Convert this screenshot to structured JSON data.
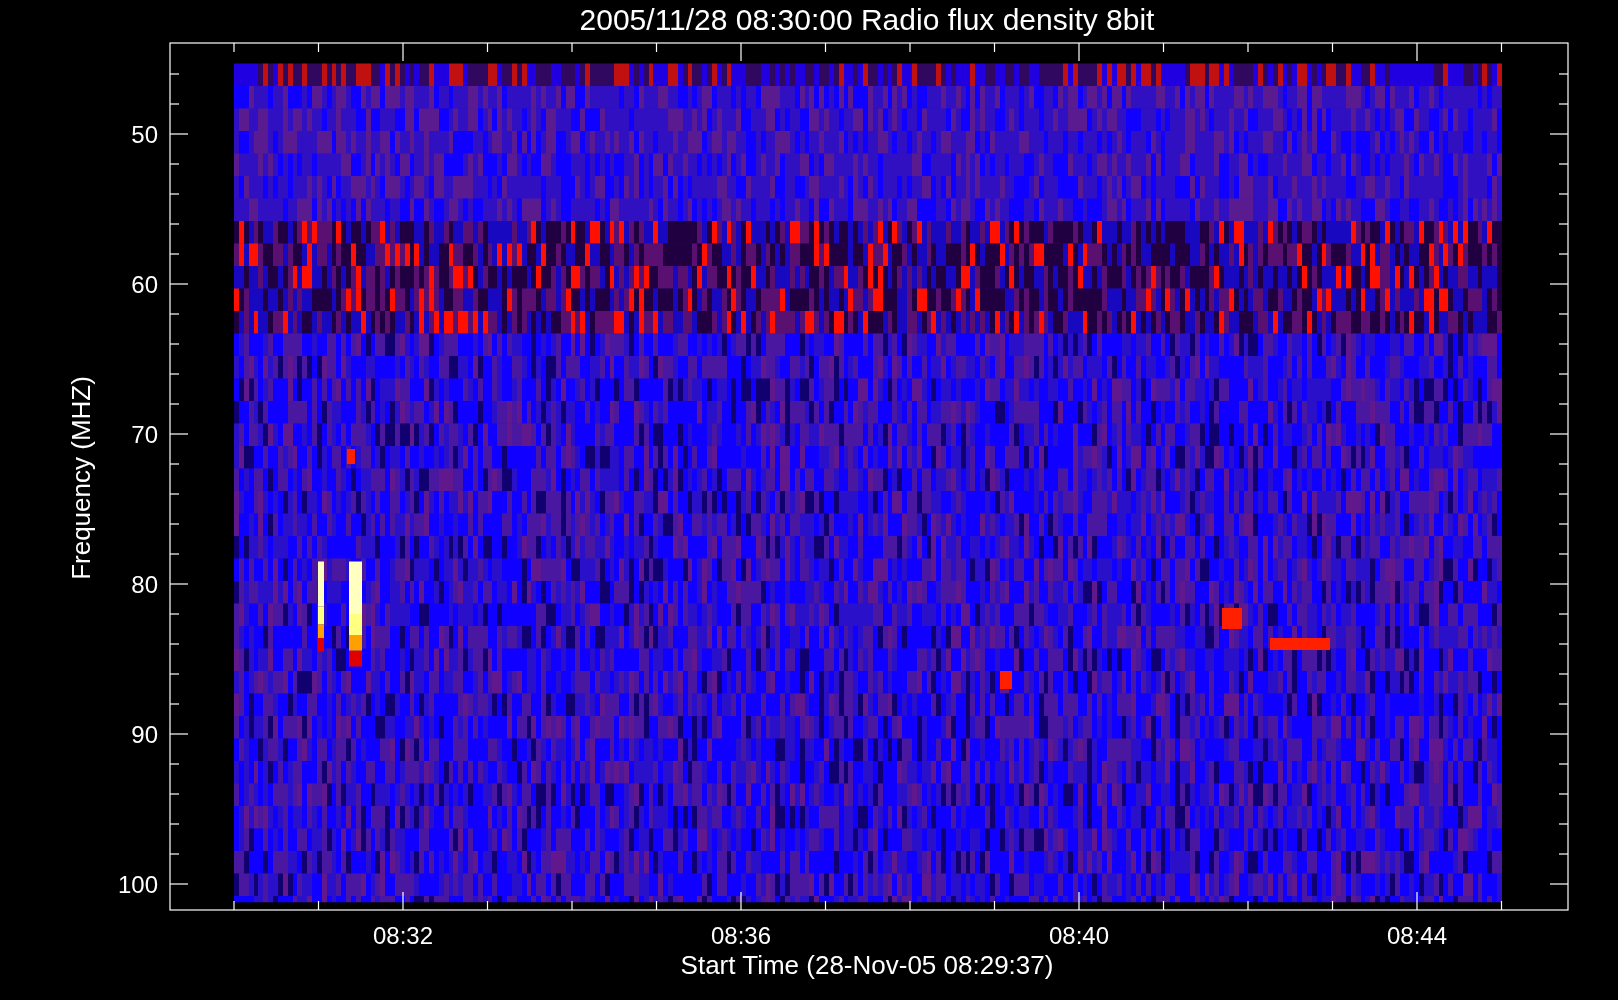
{
  "title": "2005/11/28 08:30:00 Radio flux density 8bit",
  "y_axis": {
    "label": "Frequency (MHZ)",
    "ticks": [
      "50",
      "60",
      "70",
      "80",
      "90",
      "100"
    ]
  },
  "x_axis": {
    "label": "Start Time (28-Nov-05 08:29:37)",
    "ticks": [
      "08:32",
      "08:36",
      "08:40",
      "08:44"
    ]
  }
}
